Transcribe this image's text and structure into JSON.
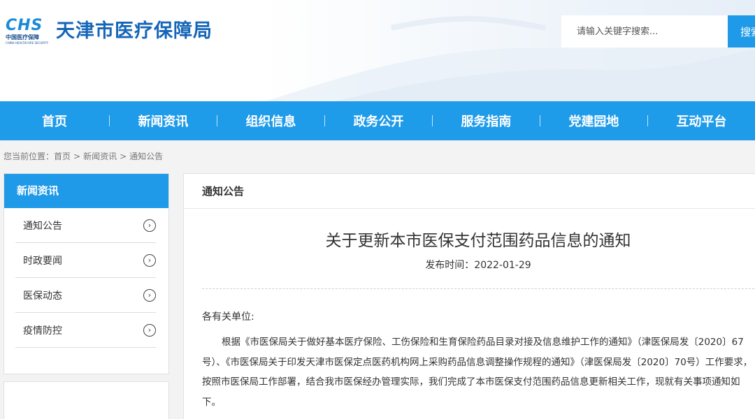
{
  "header": {
    "logo_mark": "CHS",
    "logo_cn": "中国医疗保障",
    "logo_en": "CHINA HEALTHCARE SECURITY",
    "site_title": "天津市医疗保障局",
    "search": {
      "placeholder": "请输入关键字搜索...",
      "button_label": "搜索"
    }
  },
  "nav": {
    "items": [
      {
        "label": "首页"
      },
      {
        "label": "新闻资讯"
      },
      {
        "label": "组织信息"
      },
      {
        "label": "政务公开"
      },
      {
        "label": "服务指南"
      },
      {
        "label": "党建园地"
      },
      {
        "label": "互动平台"
      }
    ]
  },
  "breadcrumb": {
    "prefix": "您当前位置：",
    "items": [
      "首页",
      "新闻资讯",
      "通知公告"
    ],
    "separator": ">"
  },
  "sidebar": {
    "title": "新闻资讯",
    "items": [
      {
        "label": "通知公告",
        "icon": "chevron-circle-right-icon"
      },
      {
        "label": "时政要闻",
        "icon": "chevron-circle-right-icon"
      },
      {
        "label": "医保动态",
        "icon": "chevron-circle-right-icon"
      },
      {
        "label": "疫情防控",
        "icon": "chevron-circle-right-icon"
      }
    ]
  },
  "content": {
    "section_title": "通知公告",
    "article": {
      "title": "关于更新本市医保支付范围药品信息的通知",
      "pubdate_label": "发布时间：",
      "pubdate": "2022-01-29",
      "salutation": "各有关单位:",
      "paragraph": "根据《市医保局关于做好基本医疗保险、工伤保险和生育保险药品目录对接及信息维护工作的通知》（津医保局发〔2020〕67号）、《市医保局关于印发天津市医保定点医药机构网上采购药品信息调整操作规程的通知》（津医保局发〔2020〕70号）工作要求，按照市医保局工作部署，结合我市医保经办管理实际，我们完成了本市医保支付范围药品信息更新相关工作，现就有关事项通知如下。"
    }
  },
  "colors": {
    "nav_blue": "#1e9be9",
    "title_blue": "#1565b8",
    "search_button": "#1f9ae8"
  }
}
